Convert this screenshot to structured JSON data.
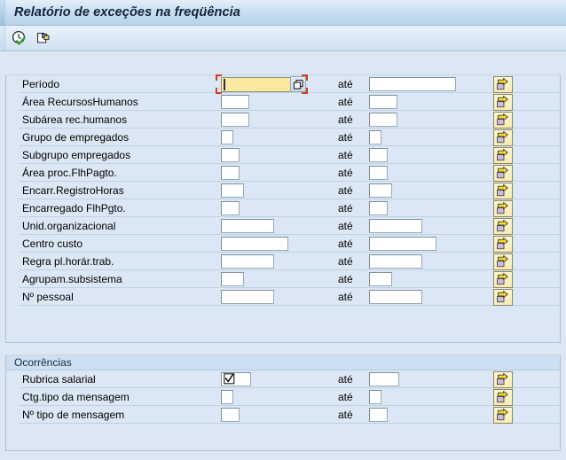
{
  "window": {
    "title": "Relatório de exceções na freqüência"
  },
  "toolbar": {
    "buttons": [
      {
        "name": "execute-clock-icon",
        "tooltip": "Executar"
      },
      {
        "name": "copy-document-icon",
        "tooltip": "Obter variante"
      }
    ]
  },
  "colors": {
    "page_background": "#dce7f3",
    "groupbox_background": "#dbe7f4",
    "groupbox_border": "#a8c2d9",
    "title_gradient_top": "#e4eefa",
    "title_gradient_bottom": "#b8d3ea",
    "focused_field": "#fbe9a0",
    "focus_bracket": "#d83b24",
    "arrow_button": "#f7ecb4",
    "arrow_glyph": "#f5d82e",
    "arrow_folder": "#cdbade"
  },
  "labels": {
    "to": "até"
  },
  "selection_group": {
    "header": "",
    "rows": [
      {
        "label": "Período",
        "from_value": "",
        "to_value": "",
        "from_width": 96,
        "to_width": 98,
        "focused": true,
        "matchcode": true,
        "arrow": true
      },
      {
        "label": "Área RecursosHumanos",
        "from_value": "",
        "to_value": "",
        "from_width": 32,
        "to_width": 32,
        "focused": false,
        "matchcode": false,
        "arrow": true
      },
      {
        "label": "Subárea rec.humanos",
        "from_value": "",
        "to_value": "",
        "from_width": 32,
        "to_width": 32,
        "focused": false,
        "matchcode": false,
        "arrow": true
      },
      {
        "label": "Grupo de empregados",
        "from_value": "",
        "to_value": "",
        "from_width": 14,
        "to_width": 14,
        "focused": false,
        "matchcode": false,
        "arrow": true
      },
      {
        "label": "Subgrupo empregados",
        "from_value": "",
        "to_value": "",
        "from_width": 21,
        "to_width": 21,
        "focused": false,
        "matchcode": false,
        "arrow": true
      },
      {
        "label": "Área proc.FlhPagto.",
        "from_value": "",
        "to_value": "",
        "from_width": 21,
        "to_width": 21,
        "focused": false,
        "matchcode": false,
        "arrow": true
      },
      {
        "label": "Encarr.RegistroHoras",
        "from_value": "",
        "to_value": "",
        "from_width": 26,
        "to_width": 26,
        "focused": false,
        "matchcode": false,
        "arrow": true
      },
      {
        "label": "Encarregado FlhPgto.",
        "from_value": "",
        "to_value": "",
        "from_width": 21,
        "to_width": 21,
        "focused": false,
        "matchcode": false,
        "arrow": true
      },
      {
        "label": "Unid.organizacional",
        "from_value": "",
        "to_value": "",
        "from_width": 60,
        "to_width": 60,
        "focused": false,
        "matchcode": false,
        "arrow": true
      },
      {
        "label": "Centro custo",
        "from_value": "",
        "to_value": "",
        "from_width": 76,
        "to_width": 76,
        "focused": false,
        "matchcode": false,
        "arrow": true
      },
      {
        "label": "Regra pl.horár.trab.",
        "from_value": "",
        "to_value": "",
        "from_width": 60,
        "to_width": 60,
        "focused": false,
        "matchcode": false,
        "arrow": true
      },
      {
        "label": "Agrupam.subsistema",
        "from_value": "",
        "to_value": "",
        "from_width": 26,
        "to_width": 26,
        "focused": false,
        "matchcode": false,
        "arrow": true
      },
      {
        "label": "Nº pessoal",
        "from_value": "",
        "to_value": "",
        "from_width": 60,
        "to_width": 60,
        "focused": false,
        "matchcode": false,
        "arrow": true
      }
    ]
  },
  "occurrences_group": {
    "header": "Ocorrências",
    "rows": [
      {
        "label": "Rubrica salarial",
        "from_value": "",
        "to_value": "",
        "from_width": 34,
        "to_width": 34,
        "has_check": true,
        "arrow": true
      },
      {
        "label": "Ctg.tipo da mensagem",
        "from_value": "",
        "to_value": "",
        "from_width": 14,
        "to_width": 14,
        "has_check": false,
        "arrow": true
      },
      {
        "label": "Nº tipo de mensagem",
        "from_value": "",
        "to_value": "",
        "from_width": 21,
        "to_width": 21,
        "has_check": false,
        "arrow": true
      }
    ]
  }
}
